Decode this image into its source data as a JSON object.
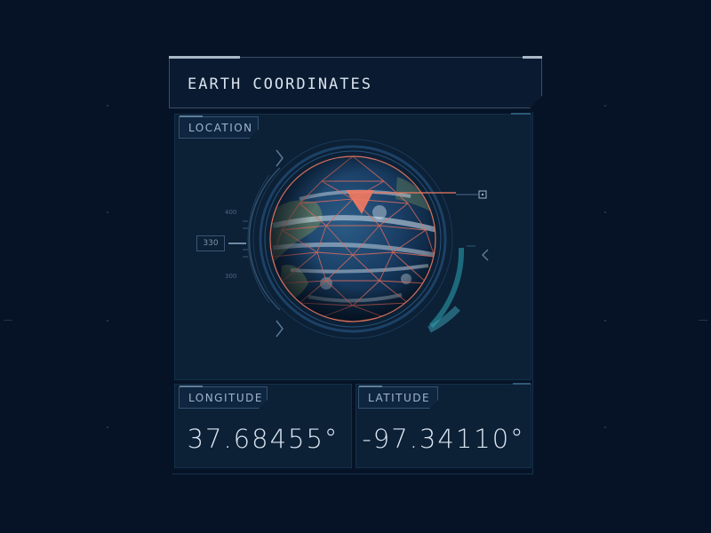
{
  "title": "EARTH COORDINATES",
  "location": {
    "label": "LOCATION",
    "scale": {
      "top": "400",
      "current": "330",
      "bottom": "300"
    }
  },
  "longitude": {
    "label": "LONGITUDE",
    "value": "37.68455°"
  },
  "latitude": {
    "label": "LATITUDE",
    "value": "-97.34110°"
  },
  "colors": {
    "background": "#061326",
    "panel": "#0c2036",
    "accent": "#f07a62",
    "text": "#d9e4ef"
  },
  "icons": [
    "chevron-left-icon",
    "globe-icon",
    "location-marker-icon"
  ]
}
